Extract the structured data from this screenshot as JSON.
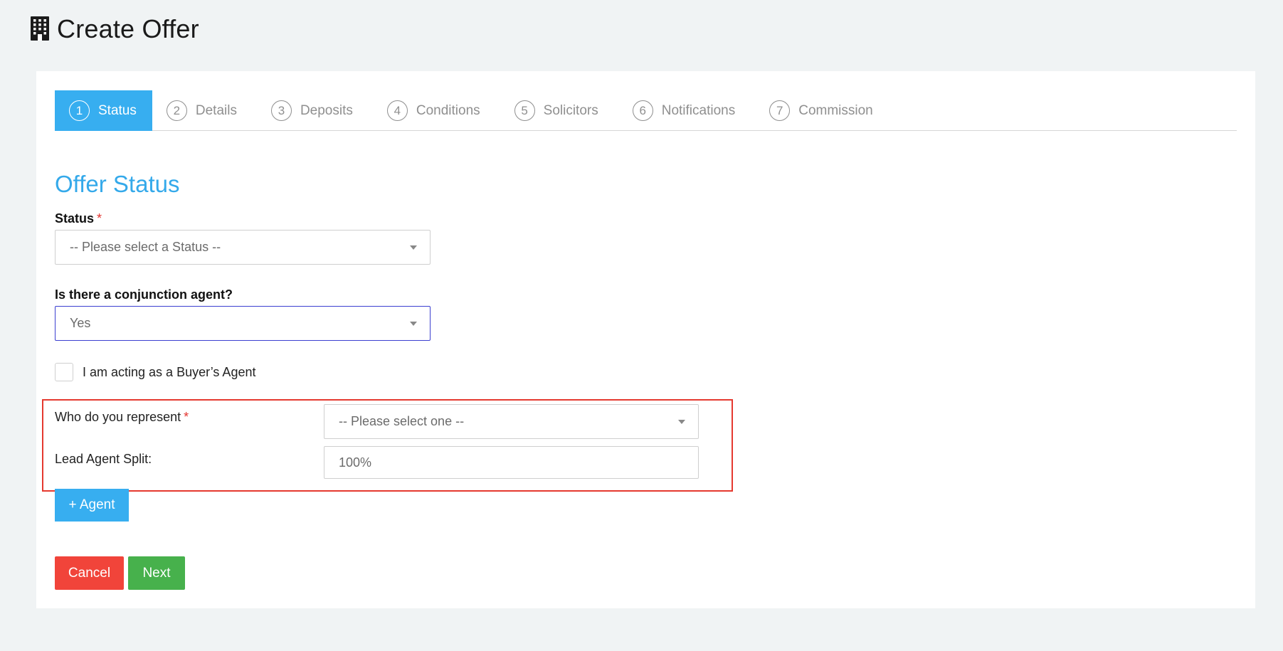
{
  "header": {
    "icon": "building-icon",
    "title": "Create Offer"
  },
  "steps": [
    {
      "number": "1",
      "label": "Status",
      "active": true
    },
    {
      "number": "2",
      "label": "Details",
      "active": false
    },
    {
      "number": "3",
      "label": "Deposits",
      "active": false
    },
    {
      "number": "4",
      "label": "Conditions",
      "active": false
    },
    {
      "number": "5",
      "label": "Solicitors",
      "active": false
    },
    {
      "number": "6",
      "label": "Notifications",
      "active": false
    },
    {
      "number": "7",
      "label": "Commission",
      "active": false
    }
  ],
  "form": {
    "section_title": "Offer Status",
    "status": {
      "label": "Status",
      "required_mark": "*",
      "selected": "-- Please select a Status --"
    },
    "conjunction": {
      "label": "Is there a conjunction agent?",
      "selected": "Yes"
    },
    "buyers_agent": {
      "label": "I am acting as a Buyer’s Agent",
      "checked": false
    },
    "represent": {
      "label": "Who do you represent",
      "required_mark": "*",
      "selected": "-- Please select one --"
    },
    "lead_split": {
      "label": "Lead Agent Split:",
      "value": "100%"
    }
  },
  "buttons": {
    "add_agent": "+ Agent",
    "cancel": "Cancel",
    "next": "Next"
  },
  "colors": {
    "accent": "#37aef0",
    "cancel": "#f1443a",
    "next": "#47b14c",
    "highlight": "#e5392f",
    "focus": "#3b3fd0"
  }
}
